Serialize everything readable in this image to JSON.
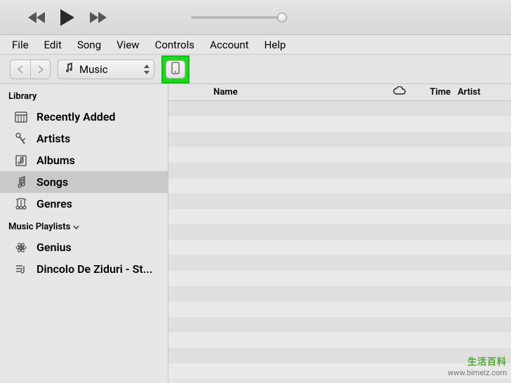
{
  "menubar": [
    "File",
    "Edit",
    "Song",
    "View",
    "Controls",
    "Account",
    "Help"
  ],
  "source": {
    "label": "Music"
  },
  "sidebar": {
    "library_header": "Library",
    "library_items": [
      {
        "icon": "recent-icon",
        "label": "Recently Added"
      },
      {
        "icon": "artist-icon",
        "label": "Artists"
      },
      {
        "icon": "album-icon",
        "label": "Albums"
      },
      {
        "icon": "song-icon",
        "label": "Songs",
        "selected": true
      },
      {
        "icon": "genre-icon",
        "label": "Genres"
      }
    ],
    "playlists_header": "Music Playlists",
    "playlist_items": [
      {
        "icon": "genius-icon",
        "label": "Genius"
      },
      {
        "icon": "playlist-icon",
        "label": "Dincolo De Ziduri - St..."
      }
    ]
  },
  "columns": {
    "name": "Name",
    "time": "Time",
    "artist": "Artist"
  },
  "watermark": {
    "line1": "生活百科",
    "line2": "www.bimeiz.com"
  }
}
